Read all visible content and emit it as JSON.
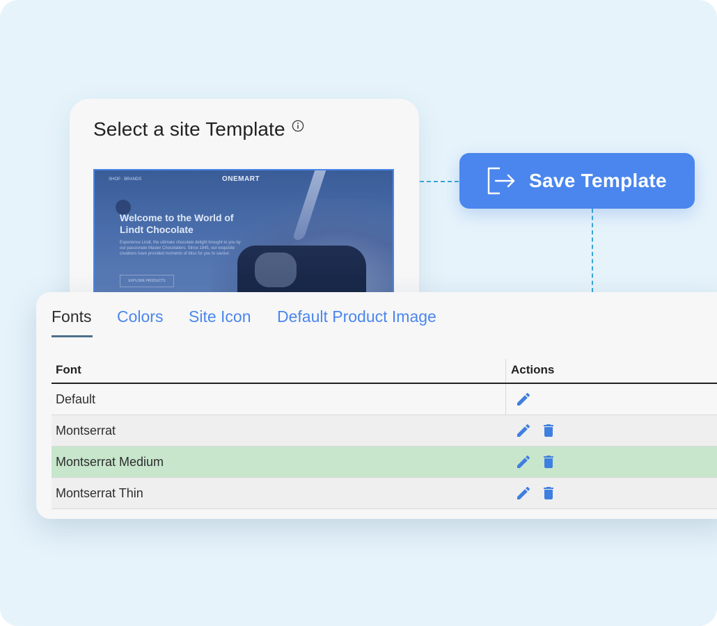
{
  "template_card": {
    "title": "Select a site Template",
    "info_icon": "info-circle-icon",
    "preview": {
      "nav_left": "SHOP · BRANDS",
      "brand": "ONEMART",
      "headline": "Welcome to the World of Lindt Chocolate",
      "body": "Experience Lindt, the ultimate chocolate delight brought to you by our passionate Master Chocolatiers. Since 1845, our exquisite creations have provided moments of bliss for you to savour.",
      "button": "EXPLORE PRODUCTS"
    }
  },
  "save_button": {
    "label": "Save Template",
    "icon": "export-arrow-icon",
    "color": "#4a86ee"
  },
  "settings": {
    "tabs": [
      {
        "label": "Fonts",
        "active": true
      },
      {
        "label": "Colors",
        "active": false
      },
      {
        "label": "Site Icon",
        "active": false
      },
      {
        "label": "Default Product Image",
        "active": false
      }
    ],
    "table": {
      "headers": {
        "font": "Font",
        "actions": "Actions"
      },
      "rows": [
        {
          "font": "Default",
          "actions": [
            "edit"
          ]
        },
        {
          "font": "Montserrat",
          "actions": [
            "edit",
            "delete"
          ]
        },
        {
          "font": "Montserrat Medium",
          "actions": [
            "edit",
            "delete"
          ],
          "selected": true
        },
        {
          "font": "Montserrat Thin",
          "actions": [
            "edit",
            "delete"
          ]
        }
      ]
    },
    "colors": {
      "accent": "#4a86ee",
      "selected_row": "#c7e6cc"
    }
  }
}
